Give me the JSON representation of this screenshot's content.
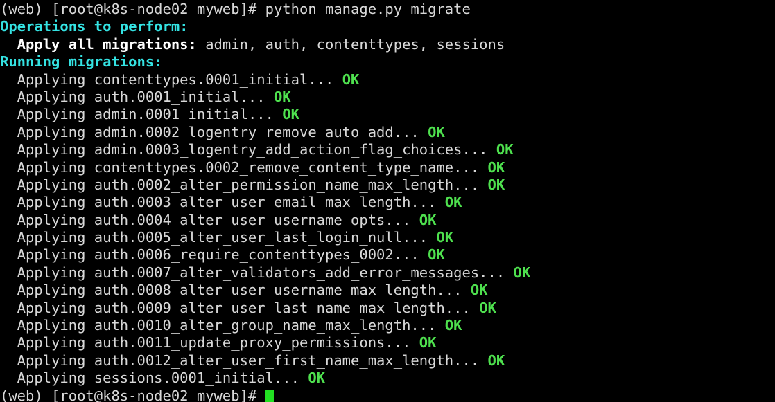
{
  "terminal": {
    "background_color": "#000000",
    "foreground_color": "#d8d8d8",
    "header_color": "#34e2e2",
    "ok_color": "#4ee04e",
    "cursor_color": "#22e022",
    "prompt": "(web) [root@k8s-node02 myweb]#",
    "command": " python manage.py migrate",
    "operations_header": "Operations to perform:",
    "apply_label": "  Apply all migrations:",
    "apply_apps": " admin, auth, contenttypes, sessions",
    "running_header": "Running migrations:",
    "applying_prefix": "  Applying ",
    "ellipsis": "... ",
    "ok_label": "OK",
    "migrations": [
      "contenttypes.0001_initial",
      "auth.0001_initial",
      "admin.0001_initial",
      "admin.0002_logentry_remove_auto_add",
      "admin.0003_logentry_add_action_flag_choices",
      "contenttypes.0002_remove_content_type_name",
      "auth.0002_alter_permission_name_max_length",
      "auth.0003_alter_user_email_max_length",
      "auth.0004_alter_user_username_opts",
      "auth.0005_alter_user_last_login_null",
      "auth.0006_require_contenttypes_0002",
      "auth.0007_alter_validators_add_error_messages",
      "auth.0008_alter_user_username_max_length",
      "auth.0009_alter_user_last_name_max_length",
      "auth.0010_alter_group_name_max_length",
      "auth.0011_update_proxy_permissions",
      "auth.0012_alter_user_first_name_max_length",
      "sessions.0001_initial"
    ],
    "final_prompt": "(web) [root@k8s-node02 myweb]# "
  }
}
